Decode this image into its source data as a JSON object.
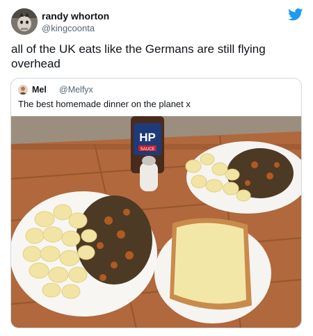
{
  "tweet": {
    "display_name": "randy whorton",
    "handle": "@kingcoonta",
    "text": "all of the UK eats like the Germans are still flying overhead",
    "platform_icon": "twitter-bird-icon",
    "brand_color": "#1d9bf0"
  },
  "quote": {
    "display_name": "Mel",
    "handle": "@Melfyx",
    "text": "The best homemade dinner on the planet x",
    "photo": {
      "bottle_label": "HP",
      "bottle_sublabel": "SAUCE"
    }
  }
}
